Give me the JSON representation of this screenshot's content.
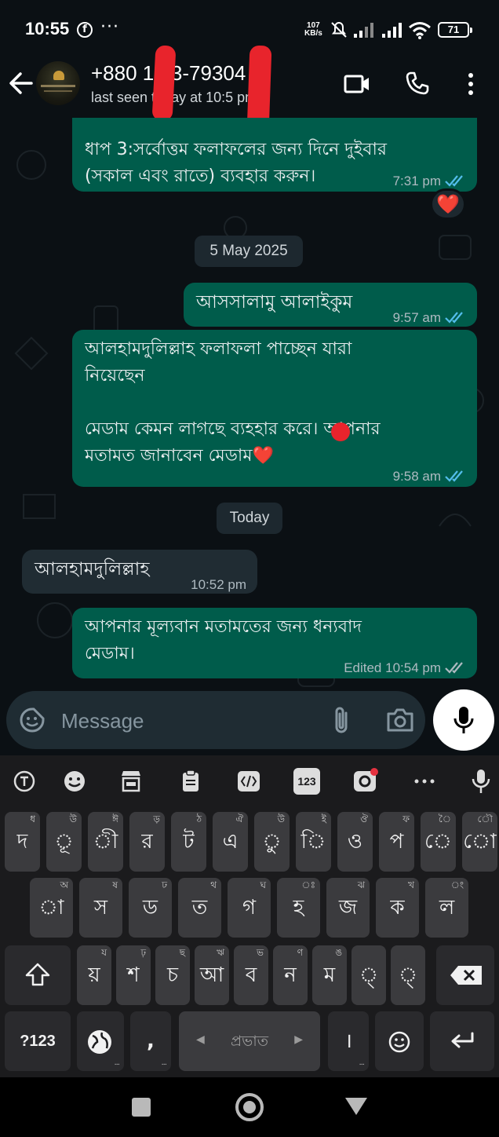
{
  "status_bar": {
    "time": "10:55",
    "net_speed_value": "107",
    "net_speed_unit": "KB/s",
    "battery": "71",
    "icons": [
      "facebook-icon",
      "more-dots-icon",
      "mute-icon",
      "signal-icon",
      "signal-icon",
      "wifi-icon",
      "battery-icon"
    ]
  },
  "header": {
    "contact_name": "+880 1 53-79304",
    "status": "last seen today at 10:5  pm",
    "icons": [
      "back-arrow-icon",
      "video-call-icon",
      "voice-call-icon",
      "more-vert-icon"
    ]
  },
  "messages": {
    "m1": {
      "text": "ধাপ 3:সর্বোত্তম ফলাফলের জন্য দিনে দুইবার\n(সকাল এবং রাতে) ব্যবহার করুন।",
      "time": "7:31 pm",
      "reaction": "❤️",
      "partial_top": "• • • • • • • • • • • • • • • • •"
    },
    "date1": "5 May 2025",
    "m2": {
      "text": "আসসালামু আলাইকুম",
      "time": "9:57 am"
    },
    "m3": {
      "text": "আলহামদুলিল্লাহ ফলাফলা পাচ্ছেন যারা\nনিয়েছেন\n\nমেডাম কেমন লাগছে ব্যহহার করে। আপনার\nমতামত জানাবেন মেডাম❤️",
      "time": "9:58 am"
    },
    "date2": "Today",
    "m4": {
      "text": "আলহামদুলিল্লাহ",
      "time": "10:52 pm"
    },
    "m5": {
      "text": "আপনার মূল্যবান মতামতের জন্য ধন্যবাদ\nমেডাম।",
      "time": "Edited 10:54 pm"
    }
  },
  "composer": {
    "placeholder": "Message",
    "icons": [
      "emoji-sticker-icon",
      "attach-icon",
      "camera-icon",
      "mic-icon"
    ]
  },
  "keyboard": {
    "toolbar_icons": [
      "translate-icon",
      "emoji-icon",
      "clipboard-store-icon",
      "clipboard-icon",
      "text-edit-icon",
      "numpad-icon",
      "gif-sticker-icon",
      "more-dots-icon",
      "voice-input-icon"
    ],
    "numpad_label": "123",
    "row1": [
      {
        "main": "দ",
        "hint": "ধ"
      },
      {
        "main": "ূ",
        "hint": "উ"
      },
      {
        "main": "ী",
        "hint": "ঈ"
      },
      {
        "main": "র",
        "hint": "ড়"
      },
      {
        "main": "ট",
        "hint": "ঠ"
      },
      {
        "main": "এ",
        "hint": "ঐ"
      },
      {
        "main": "ু",
        "hint": "উ"
      },
      {
        "main": "ি",
        "hint": "ই"
      },
      {
        "main": "ও",
        "hint": "ঔ"
      },
      {
        "main": "প",
        "hint": "ফ"
      },
      {
        "main": "ে",
        "hint": "ৈ"
      },
      {
        "main": "ো",
        "hint": "ৌ"
      }
    ],
    "row2": [
      {
        "main": "া",
        "hint": "অ"
      },
      {
        "main": "স",
        "hint": "ষ"
      },
      {
        "main": "ড",
        "hint": "ঢ"
      },
      {
        "main": "ত",
        "hint": "থ"
      },
      {
        "main": "গ",
        "hint": "ঘ"
      },
      {
        "main": "হ",
        "hint": "ঃ"
      },
      {
        "main": "জ",
        "hint": "ঝ"
      },
      {
        "main": "ক",
        "hint": "খ"
      },
      {
        "main": "ল",
        "hint": "ং"
      }
    ],
    "row3": [
      {
        "main": "য়",
        "hint": "য"
      },
      {
        "main": "শ",
        "hint": "ঢ়"
      },
      {
        "main": "চ",
        "hint": "ছ"
      },
      {
        "main": "আ",
        "hint": "ঋ"
      },
      {
        "main": "ব",
        "hint": "ভ"
      },
      {
        "main": "ন",
        "hint": "ণ"
      },
      {
        "main": "ম",
        "hint": "ঙ"
      },
      {
        "main": "্",
        "hint": ""
      },
      {
        "main": "্",
        "hint": ""
      }
    ],
    "symbols_key": "?123",
    "comma_key": ",",
    "space_label": "প্রভাত",
    "period_key": "।"
  }
}
